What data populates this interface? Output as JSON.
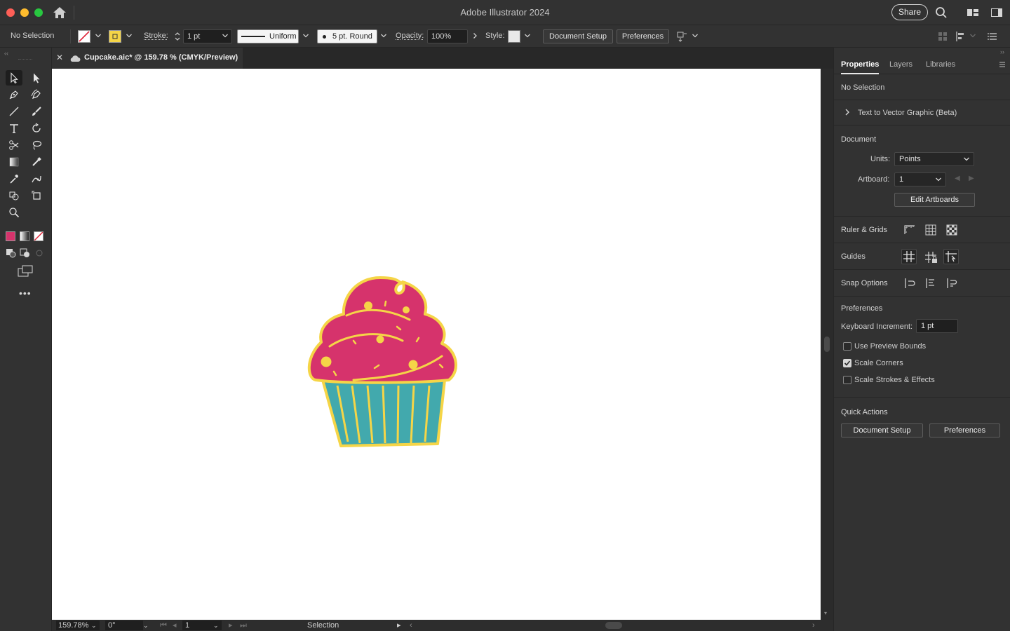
{
  "app": {
    "title": "Adobe Illustrator 2024",
    "share_label": "Share"
  },
  "controlbar": {
    "selection_status": "No Selection",
    "stroke_label": "Stroke:",
    "stroke_weight": "1 pt",
    "stroke_profile": "Uniform",
    "brush": "5 pt. Round",
    "opacity_label": "Opacity:",
    "opacity_value": "100%",
    "style_label": "Style:",
    "document_setup": "Document Setup",
    "preferences": "Preferences",
    "fill_color": "#ffffff",
    "stroke_color": "#f5d547"
  },
  "document": {
    "tab_title": "Cupcake.aic* @ 159.78 % (CMYK/Preview)"
  },
  "statusbar": {
    "zoom": "159.78%",
    "rotation": "0°",
    "artboard": "1",
    "tool": "Selection"
  },
  "panel": {
    "tabs": [
      "Properties",
      "Layers",
      "Libraries"
    ],
    "active_tab": "Properties",
    "selection_status": "No Selection",
    "text_to_vector": "Text to Vector Graphic (Beta)",
    "document_heading": "Document",
    "units_label": "Units:",
    "units_value": "Points",
    "artboard_label": "Artboard:",
    "artboard_value": "1",
    "edit_artboards": "Edit Artboards",
    "ruler_grids": "Ruler & Grids",
    "guides": "Guides",
    "snap_options": "Snap Options",
    "preferences_heading": "Preferences",
    "keyboard_increment_label": "Keyboard Increment:",
    "keyboard_increment_value": "1 pt",
    "checkboxes": [
      {
        "label": "Use Preview Bounds",
        "checked": false
      },
      {
        "label": "Scale Corners",
        "checked": true
      },
      {
        "label": "Scale Strokes & Effects",
        "checked": false
      }
    ],
    "quick_actions_heading": "Quick Actions",
    "quick_document_setup": "Document Setup",
    "quick_preferences": "Preferences"
  },
  "artwork": {
    "frosting_color": "#d6336c",
    "outline_color": "#f5d547",
    "wrapper_color": "#42a9ad",
    "sprinkle_color": "#f5d547"
  }
}
